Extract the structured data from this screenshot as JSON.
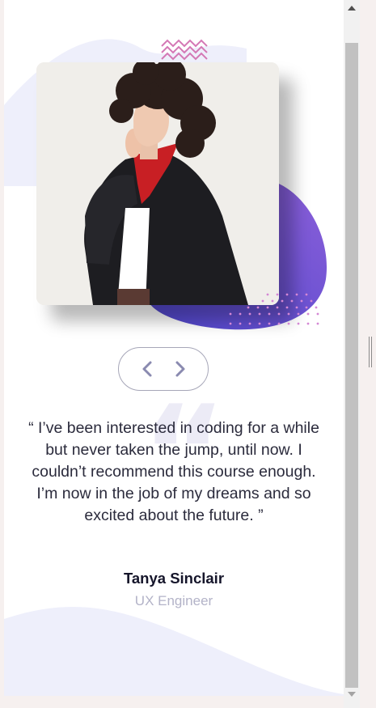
{
  "testimonial": {
    "quote": "“ I’ve been interested in coding for a while but never taken the jump, until now. I couldn’t recommend this course enough. I’m now in the job of my dreams and so excited about the future. ”",
    "name": "Tanya Sinclair",
    "role": "UX Engineer",
    "quote_mark": "“"
  },
  "navigation": {
    "prev_icon": "chevron-left-icon",
    "next_icon": "chevron-right-icon"
  },
  "colors": {
    "accent_purple": "#6d4ed6",
    "pattern_pink": "#d478b5",
    "dots_pink": "#d487d4",
    "background_curve": "#eeeffb",
    "text_dark": "#15152a",
    "text_muted": "#b3b3c8"
  },
  "photo": {
    "alt": "woman with curly hair in black coat and red scarf"
  }
}
